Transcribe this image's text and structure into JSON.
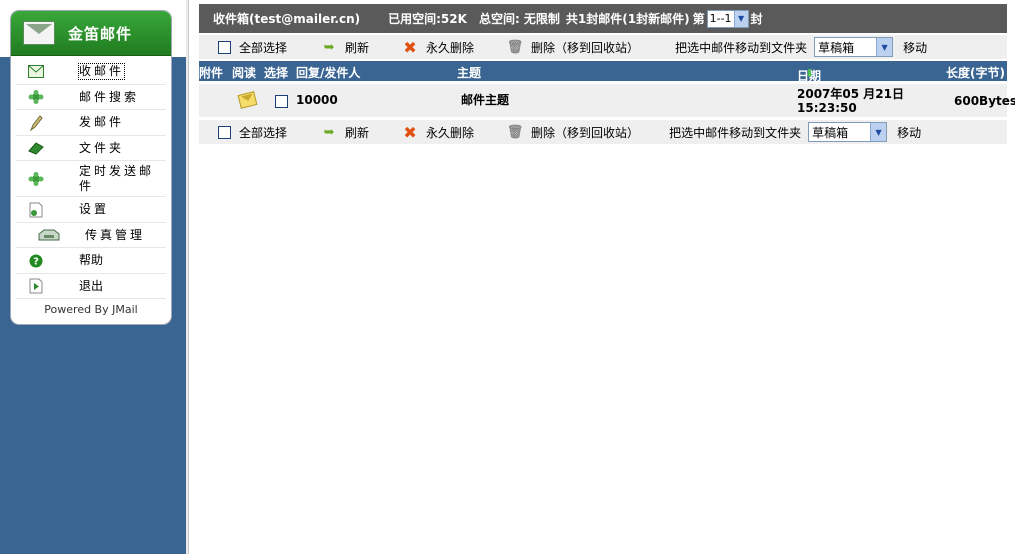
{
  "app": {
    "brand": "金笛邮件",
    "powered_by": "Powered By JMail"
  },
  "sidebar": {
    "items": [
      {
        "label": "收邮件",
        "icon": "inbox-icon"
      },
      {
        "label": "邮件搜索",
        "icon": "search-icon"
      },
      {
        "label": "发邮件",
        "icon": "compose-icon"
      },
      {
        "label": "文件夹",
        "icon": "folder-icon"
      },
      {
        "label": "定时发送邮件",
        "icon": "schedule-icon"
      },
      {
        "label": "设置",
        "icon": "settings-icon"
      },
      {
        "label": "传真管理",
        "icon": "fax-icon"
      },
      {
        "label": "帮助",
        "icon": "help-icon"
      },
      {
        "label": "退出",
        "icon": "logout-icon"
      }
    ]
  },
  "header": {
    "mailbox": "收件箱(test@mailer.cn)",
    "used_space": "已用空间:52K",
    "total_space": "总空间: 无限制",
    "summary": "共1封邮件(1封新邮件)",
    "page_prefix": "第",
    "page_value": "1--1",
    "page_suffix": "封"
  },
  "toolbar": {
    "select_all": "全部选择",
    "refresh": "刷新",
    "delete_forever": "永久删除",
    "delete_recycle": "删除（移到回收站）",
    "move_label": "把选中邮件移动到文件夹",
    "folder_value": "草稿箱",
    "move_button": "移动"
  },
  "table": {
    "headers": {
      "attachment": "附件",
      "read": "阅读",
      "select": "选择",
      "sender": "回复/发件人",
      "subject": "主题",
      "date": "日期",
      "size": "长度(字节)"
    },
    "rows": [
      {
        "sender": "10000",
        "subject": "邮件主题",
        "date_line1": "2007年05 月21日",
        "date_line2": "15:23:50",
        "size": "600Bytes"
      }
    ]
  },
  "colors": {
    "brand_green": "#2a922a",
    "nav_blue": "#3a6592",
    "topbar_gray": "#5a5a5a"
  }
}
